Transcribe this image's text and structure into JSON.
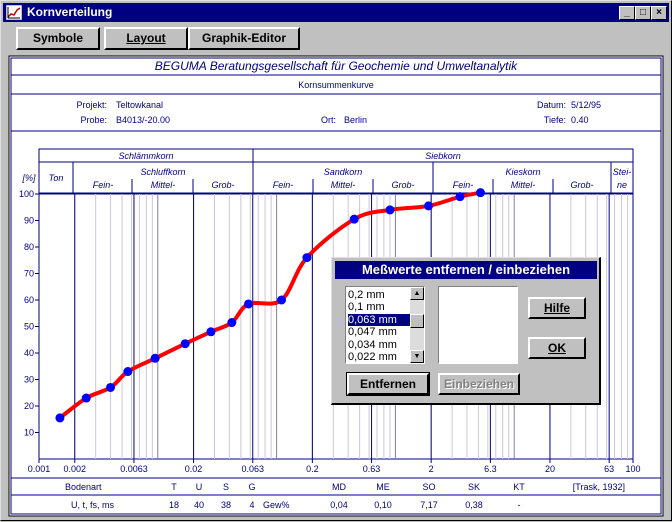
{
  "window": {
    "title": "Kornverteilung"
  },
  "toolbar": {
    "symbole": "Symbole",
    "layout": "Layout",
    "graphik_editor": "Graphik-Editor"
  },
  "report": {
    "company": "BEGUMA Beratungsgesellschaft für Geochemie und Umweltanalytik",
    "subtitle": "Kornsummenkurve",
    "projekt_label": "Projekt:",
    "projekt_value": "Teltowkanal",
    "probe_label": "Probe:",
    "probe_value": "B4013/-20.00",
    "ort_label": "Ort:",
    "ort_value": "Berlin",
    "datum_label": "Datum:",
    "datum_value": "5/12/95",
    "tiefe_label": "Tiefe:",
    "tiefe_value": "0.40"
  },
  "grain_header": {
    "schlaemmkorn": "Schlämmkorn",
    "siebkorn": "Siebkorn",
    "ton": "Ton",
    "schluffkorn": "Schluffkorn",
    "sandkorn": "Sandkorn",
    "kieskorn": "Kieskorn",
    "steine_1": "Stei-",
    "steine_2": "ne",
    "fein": "Fein-",
    "mittel": "Mittel-",
    "grob": "Grob-"
  },
  "chart_data": {
    "type": "line",
    "x_scale": "log",
    "xlim": [
      0.001,
      100
    ],
    "ylim": [
      0,
      100
    ],
    "ylabel": "[%]",
    "y_ticks": [
      "10",
      "20",
      "30",
      "40",
      "50",
      "60",
      "70",
      "80",
      "90",
      "100"
    ],
    "x_tick_labels": [
      {
        "v": 0.001,
        "t": "0.001"
      },
      {
        "v": 0.002,
        "t": "0.002"
      },
      {
        "v": 0.0063,
        "t": "0.0063"
      },
      {
        "v": 0.02,
        "t": "0.02"
      },
      {
        "v": 0.063,
        "t": "0.063"
      },
      {
        "v": 0.2,
        "t": "0.2"
      },
      {
        "v": 0.63,
        "t": "0.63"
      },
      {
        "v": 2,
        "t": "2"
      },
      {
        "v": 6.3,
        "t": "6.3"
      },
      {
        "v": 20,
        "t": "20"
      },
      {
        "v": 63,
        "t": "63"
      },
      {
        "v": 100,
        "t": "100"
      }
    ],
    "curve": [
      [
        0.0015,
        15.5
      ],
      [
        0.0025,
        23
      ],
      [
        0.004,
        27
      ],
      [
        0.0056,
        33
      ],
      [
        0.0095,
        38
      ],
      [
        0.017,
        43.5
      ],
      [
        0.028,
        48
      ],
      [
        0.042,
        51.5
      ],
      [
        0.058,
        58.5
      ],
      [
        0.11,
        60
      ],
      [
        0.18,
        76
      ],
      [
        0.45,
        90.5
      ],
      [
        0.9,
        94
      ],
      [
        1.9,
        95.5
      ],
      [
        3.5,
        99
      ],
      [
        5.2,
        100.5
      ]
    ],
    "series_color": "#ff0000",
    "marker_color": "#0000ff"
  },
  "stats": {
    "bodenart_label": "Bodenart",
    "bodenart_value": "U, t, fs, ms",
    "t_label": "T",
    "t_value": "18",
    "u_label": "U",
    "u_value": "40",
    "s_label": "S",
    "s_value": "38",
    "g_label": "G",
    "g_value": "4",
    "gew_unit": "Gew%",
    "md_label": "MD",
    "md_value": "0,04",
    "me_label": "ME",
    "me_value": "0,10",
    "so_label": "SO",
    "so_value": "7,17",
    "sk_label": "SK",
    "sk_value": "0,38",
    "kt_label": "KT",
    "kt_value": "-",
    "trask": "[Trask, 1932]"
  },
  "dialog": {
    "title": "Meßwerte entfernen / einbeziehen",
    "list_items": [
      "0,2 mm",
      "0,1 mm",
      "0,063 mm",
      "0,047 mm",
      "0,034 mm",
      "0,022 mm"
    ],
    "selected_index": 2,
    "entfernen": "Entfernen",
    "einbeziehen": "Einbeziehen",
    "hilfe": "Hilfe",
    "ok": "OK"
  }
}
